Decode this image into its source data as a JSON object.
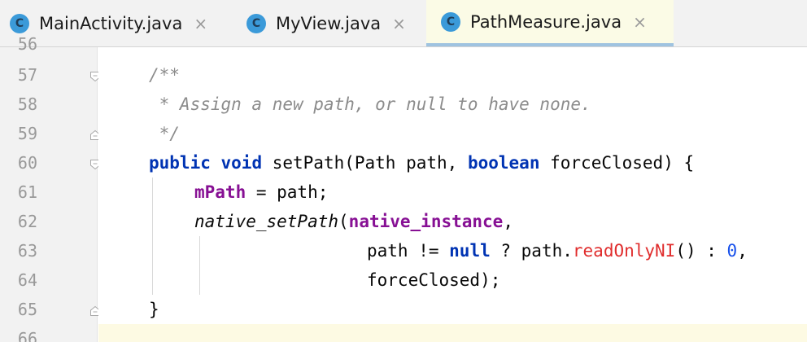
{
  "tabs": [
    {
      "label": "MainActivity.java",
      "icon": "C",
      "active": false
    },
    {
      "label": "MyView.java",
      "icon": "C",
      "active": false
    },
    {
      "label": "PathMeasure.java",
      "icon": "C",
      "active": true
    }
  ],
  "close_glyph": "×",
  "line_numbers": [
    "56",
    "57",
    "58",
    "59",
    "60",
    "61",
    "62",
    "63",
    "64",
    "65",
    "66"
  ],
  "code": {
    "l57": {
      "t0": "/**"
    },
    "l58": {
      "t0": " * Assign a new path, or null to have none."
    },
    "l59": {
      "t0": " */"
    },
    "l60": {
      "t0": "public",
      "t1": " ",
      "t2": "void",
      "t3": " setPath(Path path, ",
      "t4": "boolean",
      "t5": " forceClosed) {"
    },
    "l61": {
      "t0": "mPath",
      "t1": " = path;"
    },
    "l62": {
      "t0": "native_setPath",
      "t1": "(",
      "t2": "native_instance",
      "t3": ","
    },
    "l63": {
      "t0": "path != ",
      "t1": "null",
      "t2": " ? path.",
      "t3": "readOnlyNI",
      "t4": "() : ",
      "t5": "0",
      "t6": ","
    },
    "l64": {
      "t0": "forceClosed);"
    },
    "l65": {
      "t0": "}"
    }
  },
  "colors": {
    "keyword": "#0033b3",
    "comment": "#8c8c8c",
    "field": "#871094",
    "error_method": "#e02d2d",
    "number": "#1750eb",
    "tab_icon": "#3b9ad9",
    "active_tab_bg": "#fbfbe6",
    "active_tab_underline": "#9fc3e0"
  },
  "icons": {
    "tab_icon": "java-class-icon",
    "close": "close-icon",
    "fold_start": "fold-open-icon",
    "fold_end": "fold-close-icon"
  }
}
